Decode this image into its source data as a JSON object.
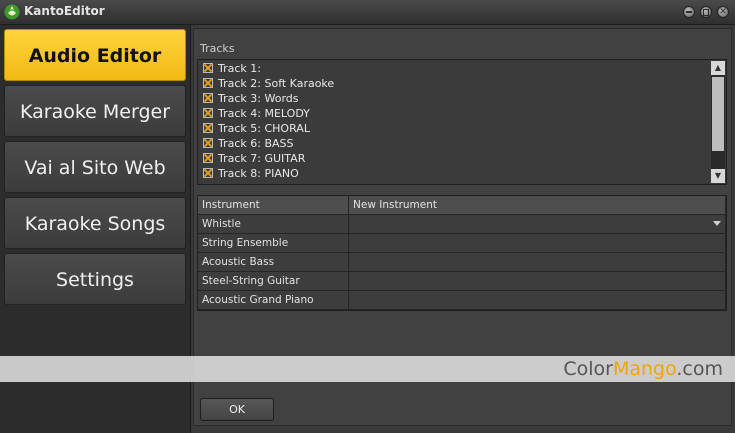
{
  "window": {
    "title": "KantoEditor"
  },
  "sidebar": {
    "items": [
      {
        "label": "Audio Editor",
        "active": true
      },
      {
        "label": "Karaoke Merger"
      },
      {
        "label": "Vai al Sito Web"
      },
      {
        "label": "Karaoke Songs"
      },
      {
        "label": "Settings"
      }
    ]
  },
  "tracks": {
    "label": "Tracks",
    "items": [
      "Track 1:",
      "Track 2: Soft Karaoke",
      "Track 3: Words",
      "Track 4: MELODY",
      "Track 5: CHORAL",
      "Track 6: BASS",
      "Track 7: GUITAR",
      "Track 8: PIANO"
    ]
  },
  "instruments": {
    "headers": [
      "Instrument",
      "New Instrument"
    ],
    "rows": [
      {
        "instrument": "Whistle",
        "new": ""
      },
      {
        "instrument": "String Ensemble",
        "new": ""
      },
      {
        "instrument": "Acoustic Bass",
        "new": ""
      },
      {
        "instrument": "Steel-String Guitar",
        "new": ""
      },
      {
        "instrument": "Acoustic Grand Piano",
        "new": ""
      }
    ]
  },
  "ok_label": "OK",
  "watermark": {
    "part1": "Color",
    "part2": "Mango",
    "part3": ".com"
  },
  "colors": {
    "accent": "#f5c518",
    "panel": "#414141",
    "sidebar": "#2c2c2c"
  },
  "icons": {
    "logo": "app-logo-icon",
    "minimize": "minimize-icon",
    "maximize": "maximize-icon",
    "close": "close-icon"
  }
}
